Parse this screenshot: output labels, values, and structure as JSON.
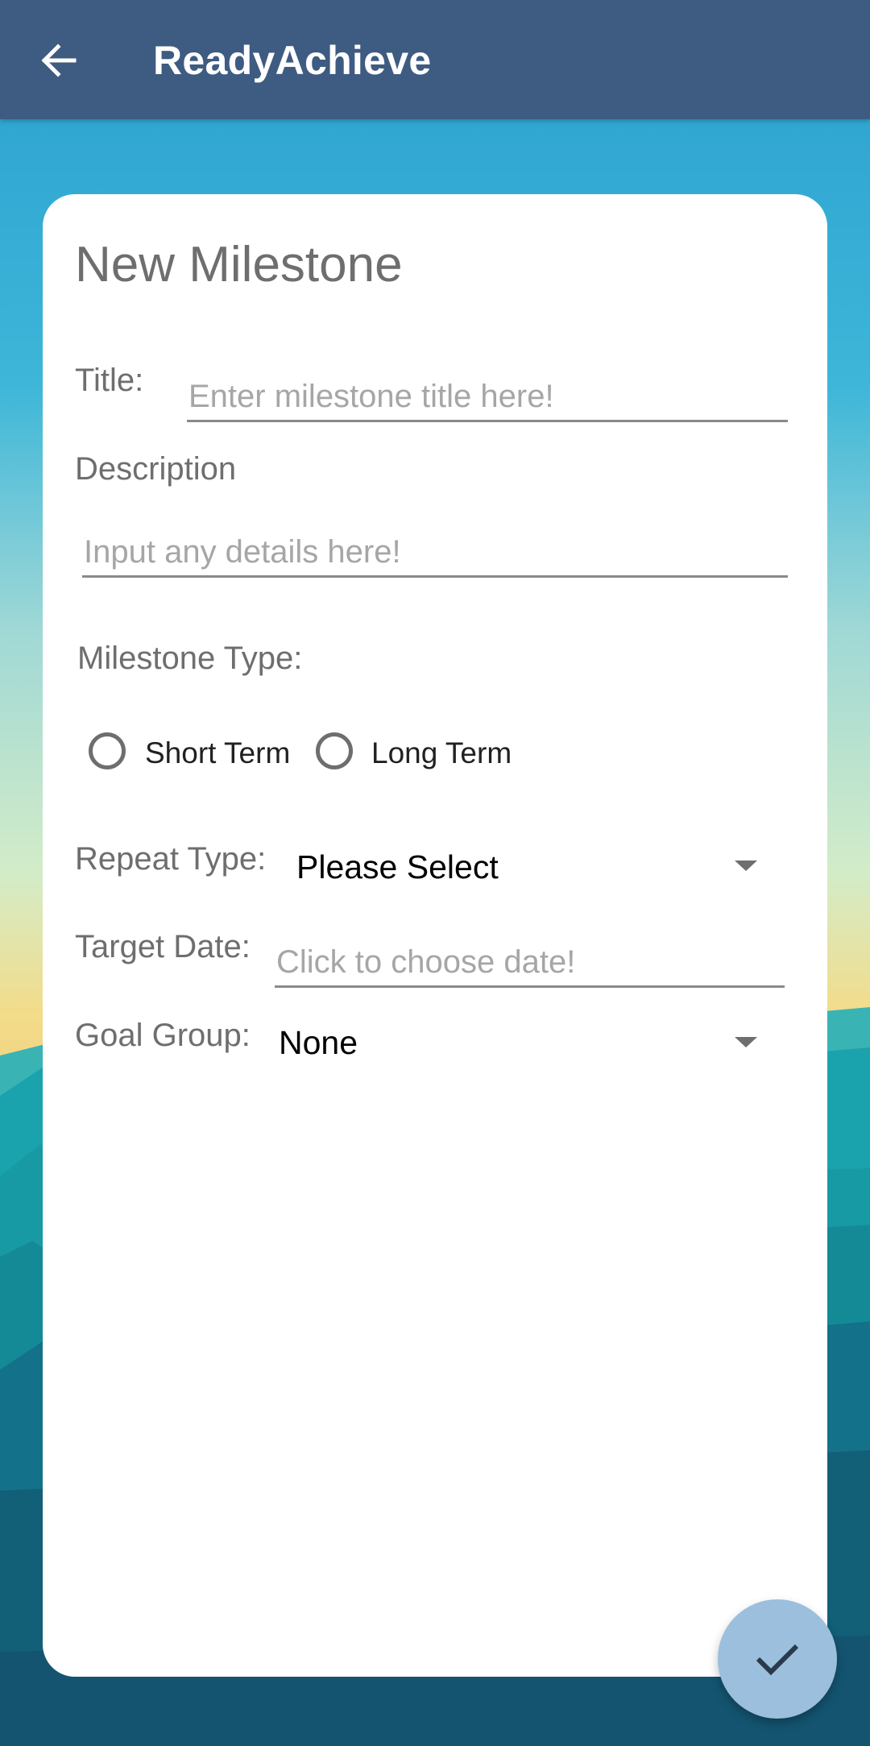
{
  "app_bar": {
    "title": "ReadyAchieve",
    "back_icon": "arrow-left-icon",
    "background": "#3e5b82"
  },
  "form": {
    "heading": "New Milestone",
    "title_label": "Title:",
    "title_placeholder": "Enter milestone title here!",
    "description_label": "Description",
    "description_placeholder": "Input any details here!",
    "milestone_type_label": "Milestone Type:",
    "milestone_type_options": [
      "Short Term",
      "Long Term"
    ],
    "repeat_type_label": "Repeat Type:",
    "repeat_type_value": "Please Select",
    "target_date_label": "Target Date:",
    "target_date_placeholder": "Click to choose date!",
    "goal_group_label": "Goal Group:",
    "goal_group_value": "None"
  },
  "fab": {
    "icon": "check-icon",
    "color": "#9bbfdc"
  }
}
